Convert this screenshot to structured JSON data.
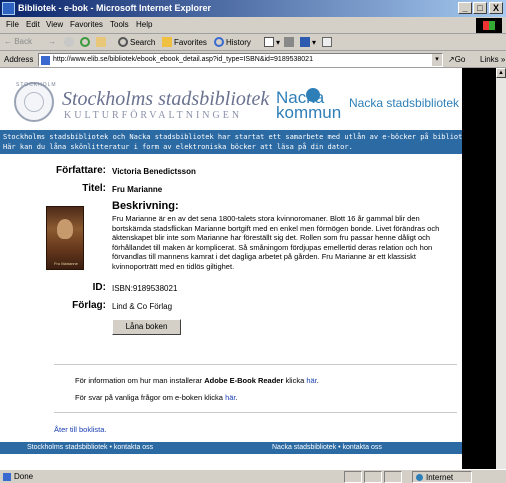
{
  "window": {
    "title": "Bibliotek - e-bok - Microsoft Internet Explorer",
    "min": "_",
    "max": "□",
    "close": "X"
  },
  "menu": [
    "File",
    "Edit",
    "View",
    "Favorites",
    "Tools",
    "Help"
  ],
  "toolbar": {
    "back": "← Back",
    "forward": "→",
    "stop": "",
    "refresh": "",
    "home": "",
    "search": "Search",
    "favorites": "Favorites",
    "history": "History"
  },
  "address": {
    "label": "Address",
    "url": "http://www.elib.se/bibliotek/ebook_ebook_detail.asp?id_type=ISBN&id=9189538021",
    "go": "Go",
    "links": "Links »"
  },
  "header": {
    "sb_name": "Stockholms stadsbibliotek",
    "sb_sub": "KULTURFÖRVALTNINGEN",
    "sb_seal": "STOCKHOLM",
    "nacka_word1": "Nacka",
    "nacka_word2": "kommun",
    "nacka_name": "Nacka stadsbibliotek"
  },
  "banner": {
    "line1": "Stockholms stadsbibliotek och Nacka stadsbibliotek har startat ett samarbete med utlån av e-böcker på bibliotekets webbsidor.",
    "line2": "Här kan du låna skönlitteratur i form av elektroniska böcker att läsa på din dator."
  },
  "book": {
    "author_label": "Författare:",
    "author": "Victoria Benedictsson",
    "title_label": "Titel:",
    "title": "Fru Marianne",
    "cover_title": "Fru Marianne",
    "desc_label": "Beskrivning:",
    "description": "Fru Marianne är en av det sena 1800-talets stora kvinnoromaner. Blott 16 år gammal blir den bortskämda stadsflickan Marianne bortgift med en enkel men förmögen bonde. Livet förändras och äktenskapet blir inte som Marianne har föreställt sig det. Rollen som fru passar henne dåligt och förhållandet till maken är komplicerat. Så småningom fördjupas emellertid deras relation och hon förvandlas till mannens kamrat i det dagliga arbetet på gården. Fru Marianne är ett klassiskt kvinnoporträtt med en tidlös giltighet.",
    "id_label": "ID:",
    "id": "ISBN:9189538021",
    "publisher_label": "Förlag:",
    "publisher": "Lind & Co Förlag",
    "loan_button": "Låna boken"
  },
  "info": {
    "line1_pre": "För information om hur man installerar ",
    "line1_bold": "Adobe E-Book Reader",
    "line1_mid": " klicka ",
    "line1_link": "här",
    "line1_end": ".",
    "line2_pre": "För svar på vanliga frågor om e-boken klicka ",
    "line2_link": "här",
    "line2_end": ".",
    "back_link": "Åter till boklista."
  },
  "footer": {
    "left": "Stockholms stadsbibliotek  •  kontakta oss",
    "right": "Nacka stadsbibliotek  •  kontakta oss"
  },
  "status": {
    "text": "Done",
    "zone": "Internet"
  }
}
